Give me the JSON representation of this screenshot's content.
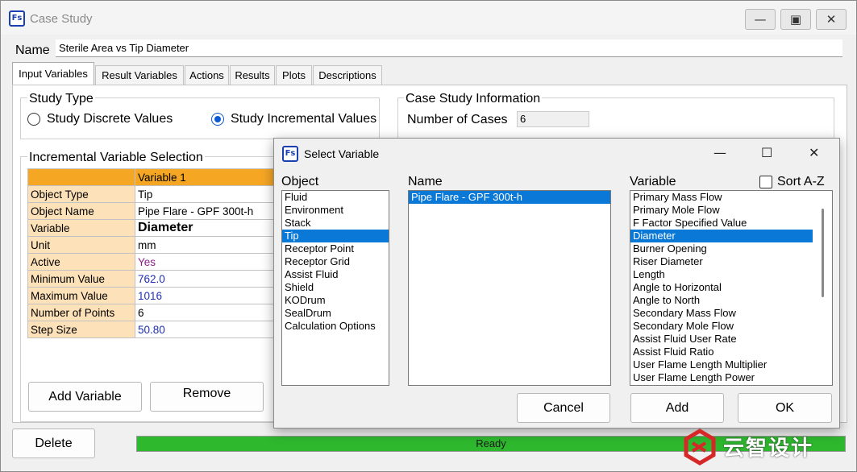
{
  "window": {
    "app_icon": "Fs",
    "title": "Case Study",
    "controls": [
      "minimize-icon",
      "maximize-icon",
      "close-icon"
    ]
  },
  "name_field": {
    "label": "Name",
    "value": "Sterile Area vs Tip Diameter"
  },
  "tabs": [
    {
      "label": "Input Variables",
      "active": true
    },
    {
      "label": "Result Variables"
    },
    {
      "label": "Actions"
    },
    {
      "label": "Results"
    },
    {
      "label": "Plots"
    },
    {
      "label": "Descriptions"
    }
  ],
  "study_type": {
    "title": "Study Type",
    "options": [
      "Study Discrete Values",
      "Study Incremental Values"
    ],
    "selected": "Study Incremental Values"
  },
  "case_info": {
    "title": "Case Study Information",
    "cases_label": "Number of Cases",
    "cases_value": "6"
  },
  "incremental": {
    "title": "Incremental Variable Selection",
    "header": "Variable 1",
    "rows": [
      {
        "label": "Object Type",
        "value": "Tip"
      },
      {
        "label": "Object Name",
        "value": "Pipe Flare - GPF 300t-h"
      },
      {
        "label": "Variable",
        "value": "Diameter"
      },
      {
        "label": "Unit",
        "value": "mm"
      },
      {
        "label": "Active",
        "value": "Yes"
      },
      {
        "label": "Minimum Value",
        "value": "762.0"
      },
      {
        "label": "Maximum Value",
        "value": "1016"
      },
      {
        "label": "Number of Points",
        "value": "6"
      },
      {
        "label": "Step Size",
        "value": "50.80"
      }
    ],
    "add_button": "Add Variable",
    "remove_button": "Remove"
  },
  "footer": {
    "delete_button": "Delete",
    "status": "Ready"
  },
  "dialog": {
    "app_icon": "Fs",
    "title": "Select Variable",
    "object_label": "Object",
    "objects": [
      "Fluid",
      "Environment",
      "Stack",
      "Tip",
      "Receptor Point",
      "Receptor Grid",
      "Assist Fluid",
      "Shield",
      "KODrum",
      "SealDrum",
      "Calculation Options"
    ],
    "object_selected": "Tip",
    "name_label": "Name",
    "names": [
      "Pipe Flare - GPF 300t-h"
    ],
    "name_selected": "Pipe Flare - GPF 300t-h",
    "variable_label": "Variable",
    "sort_label": "Sort A-Z",
    "variables": [
      "Primary Mass Flow",
      "Primary Mole Flow",
      "F Factor Specified Value",
      "Diameter",
      "Burner Opening",
      "Riser Diameter",
      "Length",
      "Angle to Horizontal",
      "Angle to North",
      "Secondary Mass Flow",
      "Secondary Mole Flow",
      "Assist Fluid User Rate",
      "Assist Fluid Ratio",
      "User Flame Length Multiplier",
      "User Flame Length Power"
    ],
    "variable_selected": "Diameter",
    "cancel_button": "Cancel",
    "add_button": "Add",
    "ok_button": "OK"
  },
  "watermark": {
    "text": "云智设计"
  },
  "colors": {
    "selection": "#0a78d7",
    "header_orange": "#f5a623",
    "label_peach": "#fde1b8",
    "status_green": "#2eb82e",
    "value_blue": "#1f2fb0",
    "logo_red": "#d62828"
  }
}
